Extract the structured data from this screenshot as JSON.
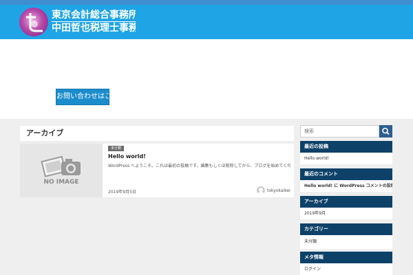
{
  "header": {
    "logo_line1": "東京会計総合事務所",
    "logo_line2": "中田哲也税理士事務所",
    "brand_color": "#1fa4e6"
  },
  "hero": {
    "button_label": "お問い合わせはこちら"
  },
  "archive": {
    "title": "アーカイブ"
  },
  "post": {
    "thumbnail_label": "NO IMAGE",
    "category": "未分類",
    "title": "Hello world!",
    "excerpt": "WordPress へようこそ。これは最初の投稿です。編集もしくは削除してから、ブログを始めてください。…",
    "date": "2019年9月5日",
    "author": "tokyokaikei"
  },
  "sidebar": {
    "search_placeholder": "検索",
    "widgets": [
      {
        "title": "最近の投稿",
        "items": [
          "Hello world!"
        ]
      },
      {
        "title": "最近のコメント",
        "items": [
          "Hello world! に WordPress コメントの投稿者 より"
        ]
      },
      {
        "title": "アーカイブ",
        "items": [
          "2019年9月"
        ]
      },
      {
        "title": "カテゴリー",
        "items": [
          "未分類"
        ]
      },
      {
        "title": "メタ情報",
        "items": [
          "ログイン"
        ]
      }
    ]
  }
}
